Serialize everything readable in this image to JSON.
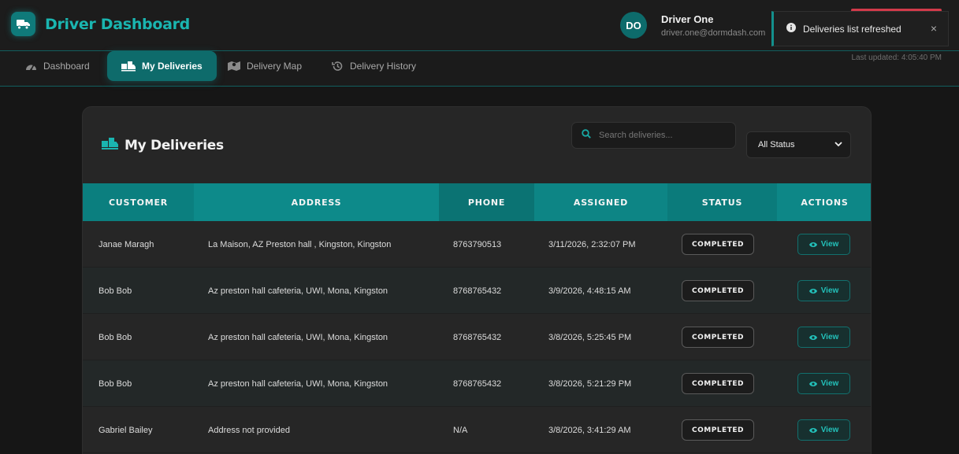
{
  "header": {
    "title": "Driver Dashboard",
    "user_initials": "DO",
    "user_name": "Driver One",
    "user_email": "driver.one@dormdash.com"
  },
  "toast": {
    "message": "Deliveries list refreshed",
    "close": "×"
  },
  "nav": {
    "tabs": [
      {
        "label": "Dashboard",
        "icon": "gauge-icon"
      },
      {
        "label": "My Deliveries",
        "icon": "deliveries-icon",
        "active": true
      },
      {
        "label": "Delivery Map",
        "icon": "map-icon"
      },
      {
        "label": "Delivery History",
        "icon": "history-icon"
      }
    ],
    "last_updated": "Last updated: 4:05:40 PM"
  },
  "card": {
    "title": "My Deliveries",
    "search_placeholder": "Search deliveries...",
    "status_filter": "All Status"
  },
  "table": {
    "columns": [
      "CUSTOMER",
      "ADDRESS",
      "PHONE",
      "ASSIGNED",
      "STATUS",
      "ACTIONS"
    ],
    "rows": [
      {
        "customer": "Janae Maragh",
        "address": "La Maison, AZ Preston hall , Kingston, Kingston",
        "phone": "8763790513",
        "assigned": "3/11/2026, 2:32:07 PM",
        "status": "COMPLETED",
        "action": "View"
      },
      {
        "customer": "Bob Bob",
        "address": "Az preston hall cafeteria, UWI, Mona, Kingston",
        "phone": "8768765432",
        "assigned": "3/9/2026, 4:48:15 AM",
        "status": "COMPLETED",
        "action": "View"
      },
      {
        "customer": "Bob Bob",
        "address": "Az preston hall cafeteria, UWI, Mona, Kingston",
        "phone": "8768765432",
        "assigned": "3/8/2026, 5:25:45 PM",
        "status": "COMPLETED",
        "action": "View"
      },
      {
        "customer": "Bob Bob",
        "address": "Az preston hall cafeteria, UWI, Mona, Kingston",
        "phone": "8768765432",
        "assigned": "3/8/2026, 5:21:29 PM",
        "status": "COMPLETED",
        "action": "View"
      },
      {
        "customer": "Gabriel Bailey",
        "address": "Address not provided",
        "phone": "N/A",
        "assigned": "3/8/2026, 3:41:29 AM",
        "status": "COMPLETED",
        "action": "View"
      }
    ]
  },
  "colors": {
    "accent": "#1ab5b0",
    "header_bg": "#0e8a8a",
    "logout": "#d23a4a"
  }
}
